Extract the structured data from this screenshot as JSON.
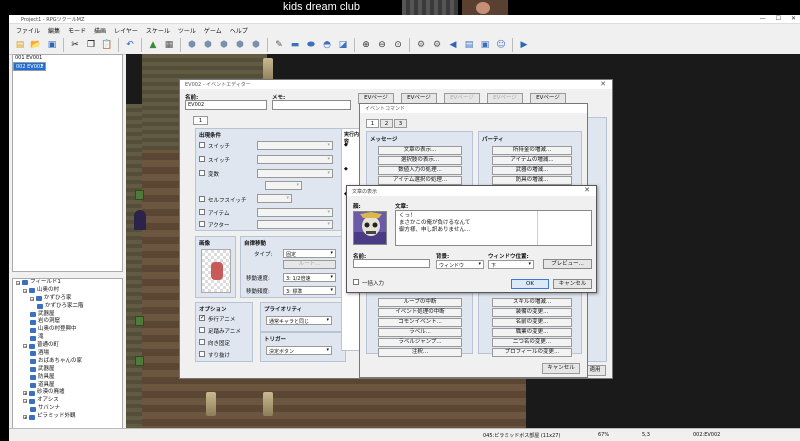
{
  "call": {
    "label": "kids dream club"
  },
  "app": {
    "title": "Project1 - RPGツクールMZ",
    "menu": [
      "ファイル",
      "編集",
      "モード",
      "描画",
      "レイヤー",
      "スケール",
      "ツール",
      "ゲーム",
      "ヘルプ"
    ]
  },
  "maplist": {
    "items": [
      "001 EV001",
      "002 EV002"
    ],
    "selected_index": 1
  },
  "tree": {
    "items": [
      {
        "label": "フィールド1",
        "depth": 0,
        "toggle": "−"
      },
      {
        "label": "山奥の村",
        "depth": 1,
        "toggle": "−"
      },
      {
        "label": "かずひろ家",
        "depth": 2,
        "toggle": "−"
      },
      {
        "label": "かずひろ家二階",
        "depth": 3,
        "toggle": ""
      },
      {
        "label": "武器屋",
        "depth": 2,
        "toggle": ""
      },
      {
        "label": "岩の洞窟",
        "depth": 2,
        "toggle": ""
      },
      {
        "label": "山奥の村登興中",
        "depth": 2,
        "toggle": ""
      },
      {
        "label": "滝",
        "depth": 2,
        "toggle": ""
      },
      {
        "label": "普通の町",
        "depth": 1,
        "toggle": "−"
      },
      {
        "label": "酒場",
        "depth": 2,
        "toggle": ""
      },
      {
        "label": "おばあちゃんの家",
        "depth": 2,
        "toggle": ""
      },
      {
        "label": "武器屋",
        "depth": 2,
        "toggle": ""
      },
      {
        "label": "防具屋",
        "depth": 2,
        "toggle": ""
      },
      {
        "label": "道具屋",
        "depth": 2,
        "toggle": ""
      },
      {
        "label": "砂漠の廃墟",
        "depth": 1,
        "toggle": "+"
      },
      {
        "label": "オアシス",
        "depth": 1,
        "toggle": "−"
      },
      {
        "label": "サバンナ",
        "depth": 2,
        "toggle": ""
      },
      {
        "label": "ピラミッド外観",
        "depth": 1,
        "toggle": "+"
      }
    ]
  },
  "status": {
    "map": "045:ピラミッドボス部屋 (11x27)",
    "zoom": "67%",
    "coords": "5,3",
    "event": "002:EV002"
  },
  "event_editor": {
    "title": "EV002 - イベントエディター",
    "name_label": "名前:",
    "name_value": "EV002",
    "memo_label": "メモ:",
    "page_buttons": [
      "EVページ\n作成",
      "EVページ\nコピー",
      "EVページ\n貼り付け",
      "EVページ\n削除",
      "EVページ\nクリア"
    ],
    "page_buttons_short": [
      "EVページ",
      "EVページ",
      "EVページ",
      "EVページ",
      "EVページ"
    ],
    "page_tab": "1",
    "conditions_title": "出現条件",
    "conditions": [
      "スイッチ",
      "スイッチ",
      "変数",
      "セルフスイッチ",
      "アイテム",
      "アクター"
    ],
    "image_title": "画像",
    "autonomous_title": "自律移動",
    "type_label": "タイプ:",
    "type_value": "固定",
    "route_button": "ルート...",
    "speed_label": "移動速度:",
    "speed_value": "3: 1/2倍速",
    "freq_label": "移動頻度:",
    "freq_value": "3: 標準",
    "options_title": "オプション",
    "options": [
      {
        "label": "歩行アニメ",
        "checked": true
      },
      {
        "label": "足踏みアニメ",
        "checked": false
      },
      {
        "label": "向き固定",
        "checked": false
      },
      {
        "label": "すり抜け",
        "checked": false
      }
    ],
    "priority_title": "プライオリティ",
    "priority_value": "通常キャラと同じ",
    "trigger_title": "トリガー",
    "trigger_value": "決定ボタン",
    "contents_title": "実行内容",
    "cancel_label": "キャンセル",
    "apply_label": "適用"
  },
  "command_window": {
    "title": "イベントコマンド",
    "tabs": [
      "1",
      "2",
      "3"
    ],
    "left_title": "メッセージ",
    "left": [
      "文章の表示...",
      "選択肢の表示...",
      "数値入力の処理...",
      "アイテム選択の処理...",
      "文章のスクロール表示...",
      "",
      "",
      "",
      "",
      "",
      "",
      "",
      "",
      "",
      "",
      "ループの中断",
      "イベント処理の中断",
      "コモンイベント...",
      "ラベル...",
      "ラベルジャンプ...",
      "注釈..."
    ],
    "right_title": "パーティ",
    "right": [
      "所持金の増減...",
      "アイテムの増減...",
      "武器の増減...",
      "防具の増減...",
      "メンバーの入れ替え",
      "",
      "",
      "",
      "",
      "",
      "",
      "",
      "",
      "",
      "",
      "スキルの増減...",
      "装備の変更...",
      "名前の変更...",
      "職業の変更...",
      "二つ名の変更...",
      "プロフィールの変更..."
    ],
    "cancel_label": "キャンセル"
  },
  "text_window": {
    "title": "文章の表示",
    "face_label": "顔:",
    "text_label": "文章:",
    "lines": [
      "くっ！",
      "まさかこの俺が負けるなんて",
      "御方様、申し訳ありません…"
    ],
    "name_label": "名前:",
    "background_label": "背景:",
    "background_value": "ウィンドウ",
    "position_label": "ウィンドウ位置:",
    "position_value": "下",
    "preview_label": "プレビュー...",
    "batch_label": "一括入力",
    "ok_label": "OK",
    "cancel_label": "キャンセル"
  },
  "colors": {
    "selection": "#1e6fd1",
    "group_bg": "#dfe6f0",
    "app_bg": "#f0f0f0"
  }
}
